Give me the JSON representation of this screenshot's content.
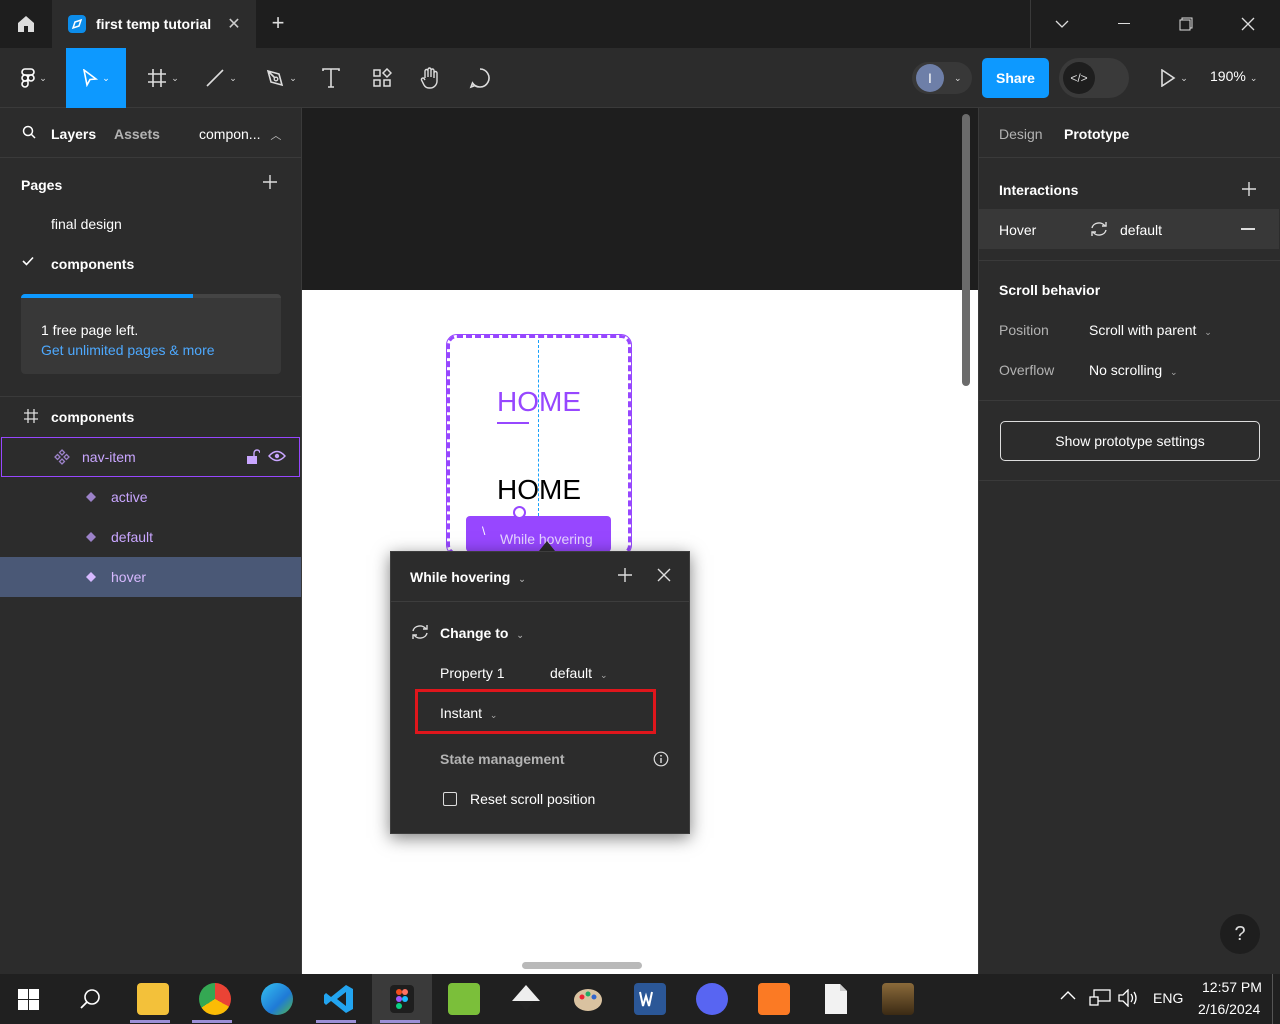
{
  "titlebar": {
    "tab_title": "first temp tutorial",
    "close_symbol": "✕",
    "new_tab_symbol": "+"
  },
  "toolbar": {
    "share_label": "Share",
    "avatar_initial": "I",
    "zoom": "190%"
  },
  "left_panel": {
    "tabs": {
      "layers": "Layers",
      "assets": "Assets",
      "page_selector": "compon..."
    },
    "pages_header": "Pages",
    "pages": [
      "final design",
      "components"
    ],
    "banner": {
      "line1": "1 free page left.",
      "link": "Get unlimited pages & more",
      "progress": 0.66
    },
    "layers": {
      "frame": "components",
      "component_set": "nav-item",
      "variants": [
        "active",
        "default",
        "hover"
      ]
    }
  },
  "canvas": {
    "home_active": "HOME",
    "home_default": "HOME",
    "tooltip": "While hovering"
  },
  "popup": {
    "trigger": "While hovering",
    "action": "Change to",
    "property_label": "Property 1",
    "property_value": "default",
    "animation": "Instant",
    "state_management": "State management",
    "reset_scroll": "Reset scroll position"
  },
  "right_panel": {
    "tabs": {
      "design": "Design",
      "prototype": "Prototype"
    },
    "interactions_header": "Interactions",
    "interaction": {
      "trigger": "Hover",
      "destination": "default"
    },
    "scroll_header": "Scroll behavior",
    "position_label": "Position",
    "position_value": "Scroll with parent",
    "overflow_label": "Overflow",
    "overflow_value": "No scrolling",
    "settings_button": "Show prototype settings",
    "help": "?"
  },
  "taskbar": {
    "lang": "ENG",
    "time": "12:57 PM",
    "date": "2/16/2024"
  },
  "colors": {
    "accent_blue": "#0d99ff",
    "component_purple": "#9747ff",
    "highlight_red": "#e0161c",
    "selected_row": "#4a5876"
  }
}
